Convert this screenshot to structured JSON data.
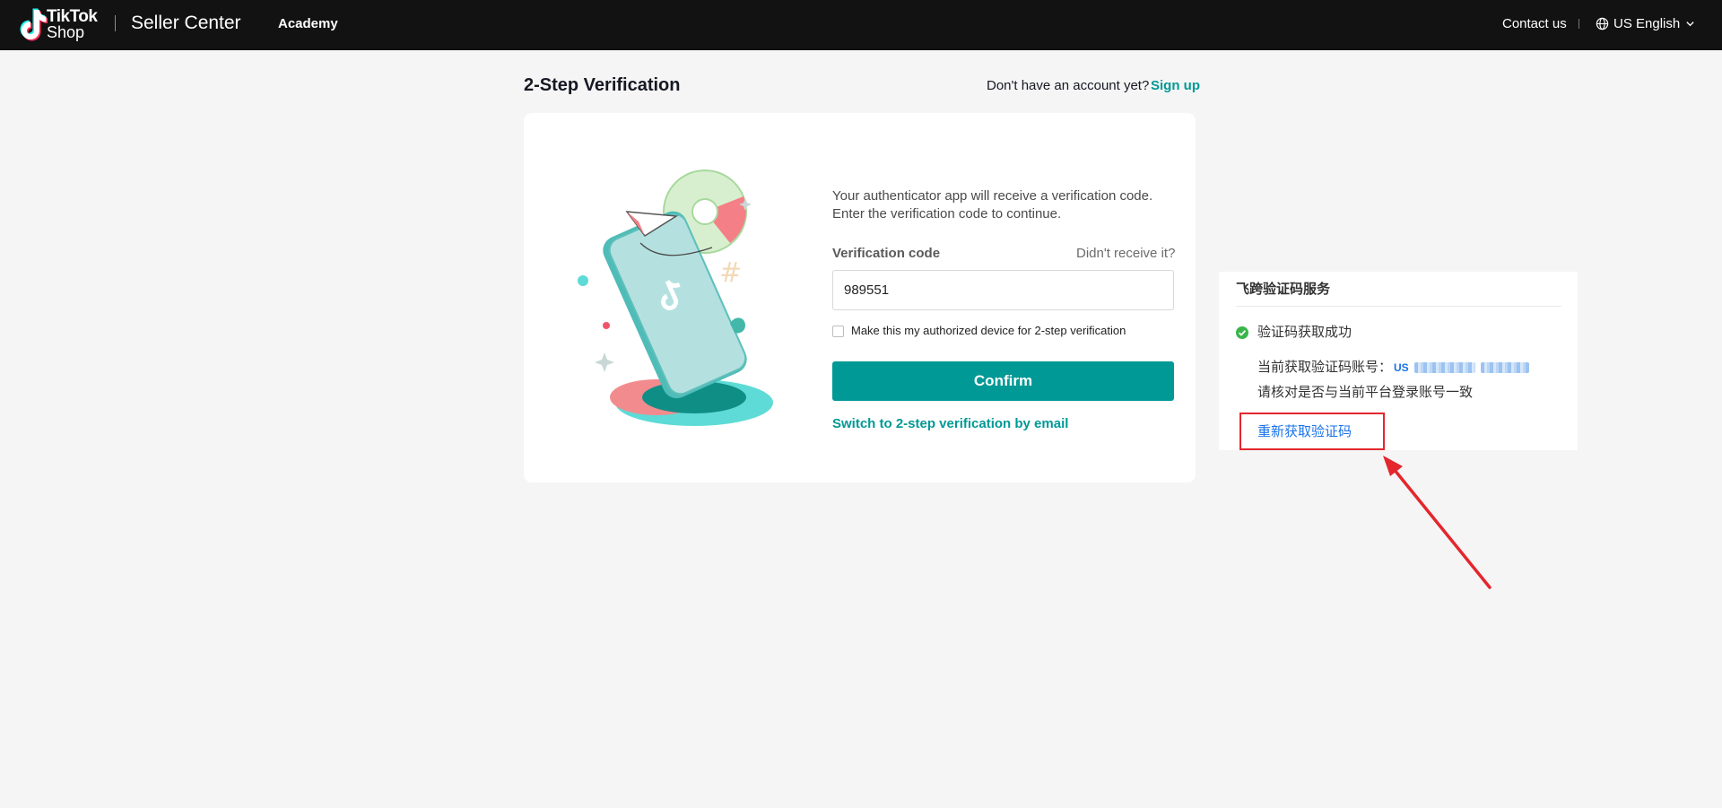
{
  "header": {
    "brand_line1": "TikTok",
    "brand_line2": "Shop",
    "product": "Seller Center",
    "nav_academy": "Academy",
    "contact": "Contact us",
    "language": "US English"
  },
  "page": {
    "title": "2-Step Verification",
    "no_account": "Don't have an account yet?",
    "sign_up": "Sign up"
  },
  "form": {
    "info_line1": "Your authenticator app will receive a verification code.",
    "info_line2": "Enter the verification code to continue.",
    "code_label": "Verification code",
    "didnt_receive": "Didn't receive it?",
    "code_value": "989551",
    "remember_label": "Make this my authorized device for 2-step verification",
    "remember_checked": false,
    "confirm": "Confirm",
    "switch_email": "Switch to 2-step verification by email"
  },
  "panel": {
    "title": "飞跨验证码服务",
    "success": "验证码获取成功",
    "account_label": "当前获取验证码账号：",
    "account_prefix": "US",
    "verify_note": "请核对是否与当前平台登录账号一致",
    "refetch": "重新获取验证码"
  },
  "colors": {
    "topbar": "#121212",
    "accent": "#009995",
    "link_blue": "#1a73e8",
    "highlight_red": "#e4262d",
    "success_green": "#3ab54a"
  },
  "icons": [
    "tiktok-logo-icon",
    "globe-icon",
    "chevron-down-icon",
    "check-circle-icon"
  ]
}
